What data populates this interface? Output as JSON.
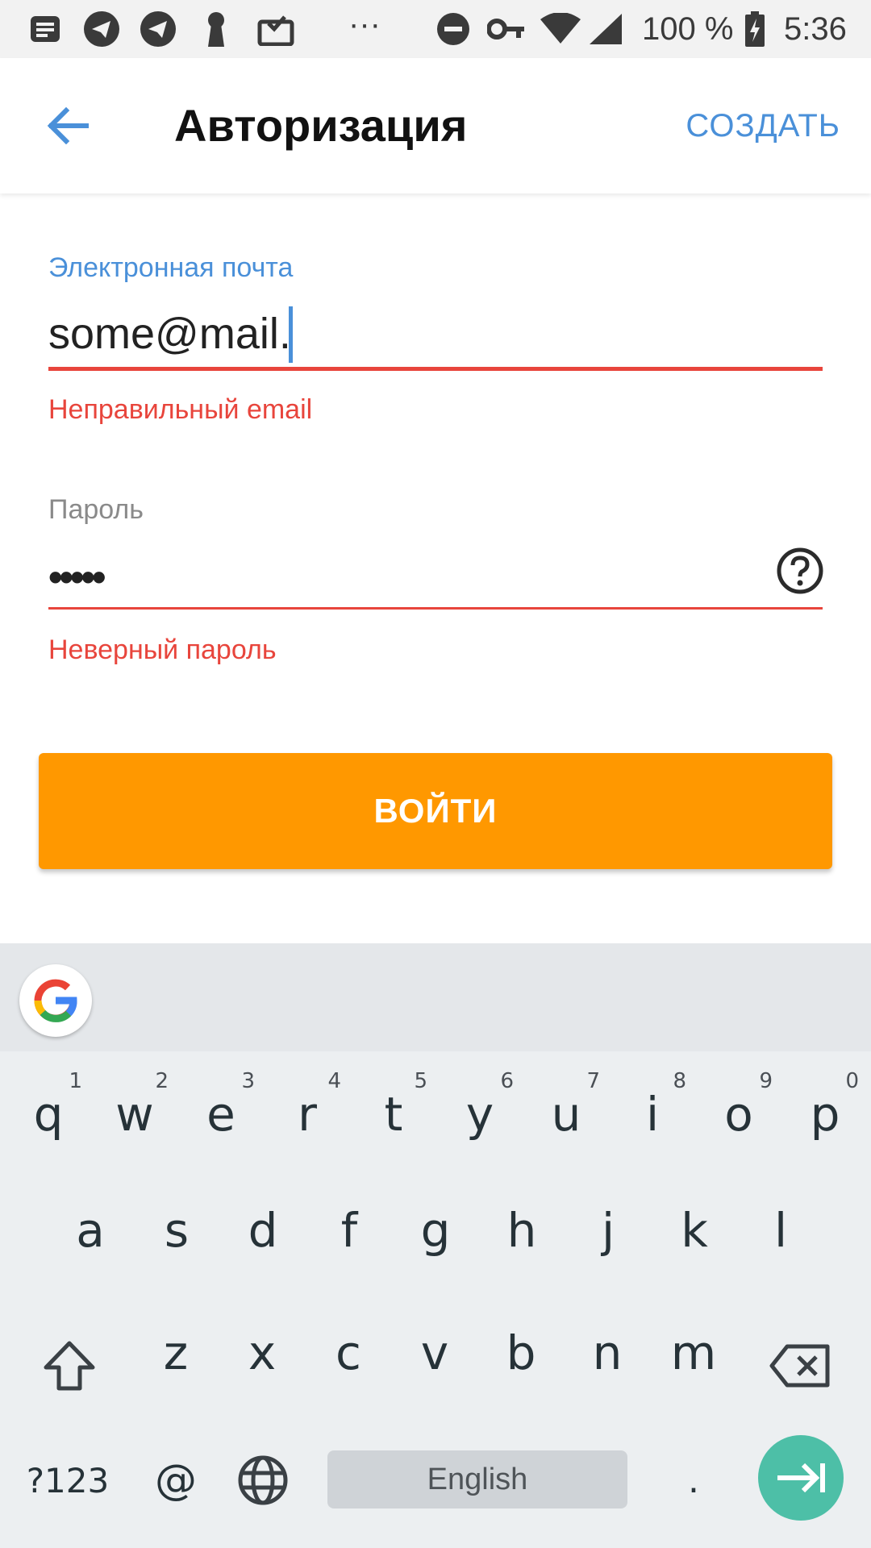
{
  "status_bar": {
    "battery_text": "100 %",
    "time": "5:36",
    "more": "···"
  },
  "app_bar": {
    "title": "Авторизация",
    "action_label": "СОЗДАТЬ"
  },
  "form": {
    "email": {
      "label": "Электронная почта",
      "value": "some@mail.",
      "error": "Неправильный email"
    },
    "password": {
      "label": "Пароль",
      "value": "•••••",
      "error": "Неверный пароль"
    },
    "submit_label": "ВОЙТИ"
  },
  "keyboard": {
    "row1": [
      {
        "key": "q",
        "hint": "1"
      },
      {
        "key": "w",
        "hint": "2"
      },
      {
        "key": "e",
        "hint": "3"
      },
      {
        "key": "r",
        "hint": "4"
      },
      {
        "key": "t",
        "hint": "5"
      },
      {
        "key": "y",
        "hint": "6"
      },
      {
        "key": "u",
        "hint": "7"
      },
      {
        "key": "i",
        "hint": "8"
      },
      {
        "key": "o",
        "hint": "9"
      },
      {
        "key": "p",
        "hint": "0"
      }
    ],
    "row2": [
      "a",
      "s",
      "d",
      "f",
      "g",
      "h",
      "j",
      "k",
      "l"
    ],
    "row3": [
      "z",
      "x",
      "c",
      "v",
      "b",
      "n",
      "m"
    ],
    "symbols_label": "?123",
    "at_label": "@",
    "space_label": "English",
    "period_label": "."
  },
  "colors": {
    "accent": "#4a90d9",
    "error": "#e8453c",
    "button": "#ff9800",
    "enter_key": "#4dbfa7"
  }
}
